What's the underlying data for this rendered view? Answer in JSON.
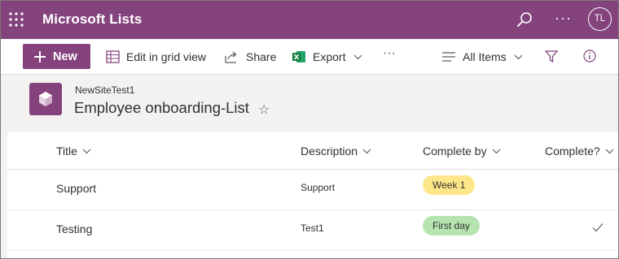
{
  "suite": {
    "app_title": "Microsoft Lists",
    "avatar_initials": "TL",
    "accent": "#84437d"
  },
  "commands": {
    "new_label": "New",
    "edit_grid": "Edit in grid view",
    "share": "Share",
    "export": "Export",
    "more": "···",
    "view": "All Items"
  },
  "header": {
    "site_name": "NewSiteTest1",
    "list_title": "Employee onboarding-List",
    "star": "☆"
  },
  "columns": [
    "Title",
    "Description",
    "Complete by",
    "Complete?"
  ],
  "rows": [
    {
      "title": "Support",
      "description": "Support",
      "complete_by": "Week 1",
      "complete_by_color": "#fce100",
      "complete": false
    },
    {
      "title": "Testing",
      "description": "Test1",
      "complete_by": "First day",
      "complete_by_color": "#a9e1a3",
      "complete": true
    }
  ]
}
